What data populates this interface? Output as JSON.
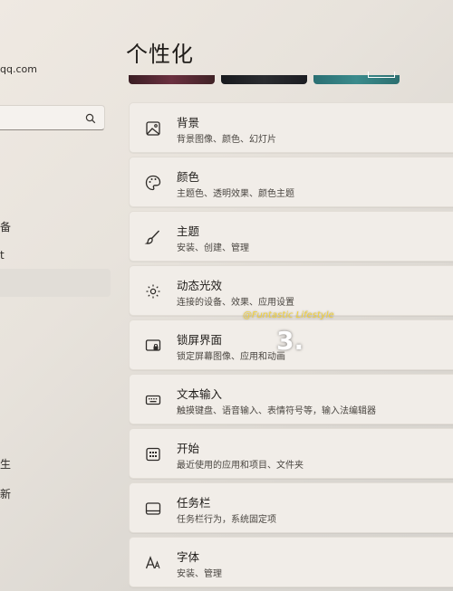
{
  "sidebar": {
    "email_fragment": "qq.com",
    "nav_fragments": [
      "备",
      "t",
      "生",
      "新"
    ]
  },
  "page": {
    "title": "个性化"
  },
  "settings": [
    {
      "title": "背景",
      "subtitle": "背景图像、颜色、幻灯片",
      "icon": "image-icon"
    },
    {
      "title": "颜色",
      "subtitle": "主题色、透明效果、颜色主题",
      "icon": "palette-icon"
    },
    {
      "title": "主题",
      "subtitle": "安装、创建、管理",
      "icon": "brush-icon"
    },
    {
      "title": "动态光效",
      "subtitle": "连接的设备、效果、应用设置",
      "icon": "dynamic-lighting-icon"
    },
    {
      "title": "锁屏界面",
      "subtitle": "锁定屏幕图像、应用和动画",
      "icon": "lock-screen-icon"
    },
    {
      "title": "文本输入",
      "subtitle": "触摸键盘、语音输入、表情符号等，输入法编辑器",
      "icon": "keyboard-icon"
    },
    {
      "title": "开始",
      "subtitle": "最近使用的应用和项目、文件夹",
      "icon": "start-menu-icon"
    },
    {
      "title": "任务栏",
      "subtitle": "任务栏行为，系统固定项",
      "icon": "taskbar-icon"
    },
    {
      "title": "字体",
      "subtitle": "安装、管理",
      "icon": "fonts-icon"
    }
  ],
  "overlay": {
    "tag": "@Funtastic Lifestyle",
    "step": "3."
  }
}
